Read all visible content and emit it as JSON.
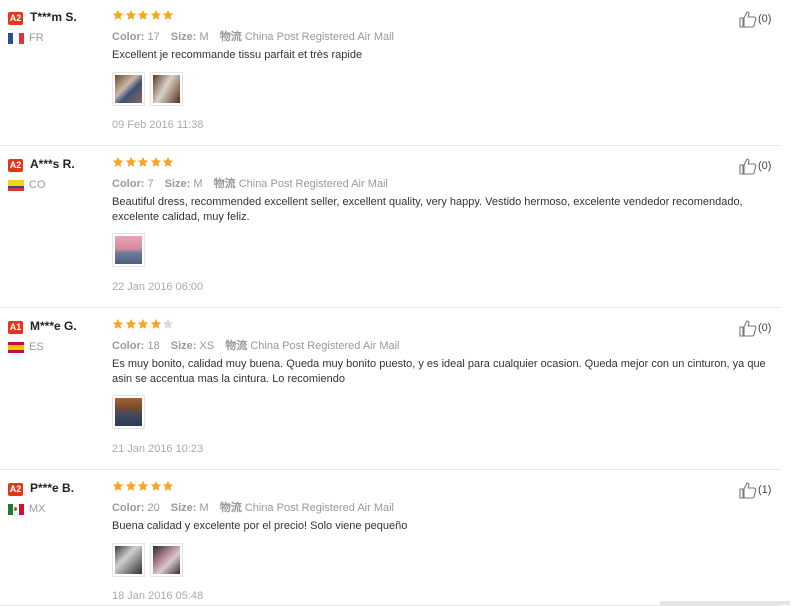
{
  "reviews": [
    {
      "level": "A2",
      "name": "T***m S.",
      "country": "FR",
      "rating": 5,
      "color_label": "Color:",
      "color_value": "17",
      "size_label": "Size:",
      "size_value": "M",
      "shipping_label": "物流",
      "shipping_value": "China Post Registered Air Mail",
      "text": "Excellent je recommande tissu parfait et très rapide",
      "photos": 2,
      "date": "09 Feb 2016 11:38",
      "helpful": "(0)"
    },
    {
      "level": "A2",
      "name": "A***s R.",
      "country": "CO",
      "rating": 5,
      "color_label": "Color:",
      "color_value": "7",
      "size_label": "Size:",
      "size_value": "M",
      "shipping_label": "物流",
      "shipping_value": "China Post Registered Air Mail",
      "text": "Beautiful dress, recommended excellent seller, excellent quality, very happy. Vestido hermoso, excelente vendedor recomendado, excelente calidad, muy feliz.",
      "photos": 1,
      "date": "22 Jan 2016 06:00",
      "helpful": "(0)"
    },
    {
      "level": "A1",
      "name": "M***e G.",
      "country": "ES",
      "rating": 4,
      "color_label": "Color:",
      "color_value": "18",
      "size_label": "Size:",
      "size_value": "XS",
      "shipping_label": "物流",
      "shipping_value": "China Post Registered Air Mail",
      "text": "Es muy bonito, calidad muy buena. Queda muy bonito puesto, y es ideal para cualquier ocasion. Queda mejor con un cinturon, ya que asin se accentua mas la cintura. Lo recomiendo",
      "photos": 1,
      "date": "21 Jan 2016 10:23",
      "helpful": "(0)"
    },
    {
      "level": "A2",
      "name": "P***e B.",
      "country": "MX",
      "rating": 5,
      "color_label": "Color:",
      "color_value": "20",
      "size_label": "Size:",
      "size_value": "M",
      "shipping_label": "物流",
      "shipping_value": "China Post Registered Air Mail",
      "text": "Buena calidad y excelente por el precio! Solo viene pequeño",
      "photos": 2,
      "date": "18 Jan 2016 05:48",
      "helpful": "(1)"
    }
  ],
  "colors": {
    "star_filled": "#f5a623",
    "star_empty": "#d9d9d9",
    "badge": "#e2371b"
  }
}
